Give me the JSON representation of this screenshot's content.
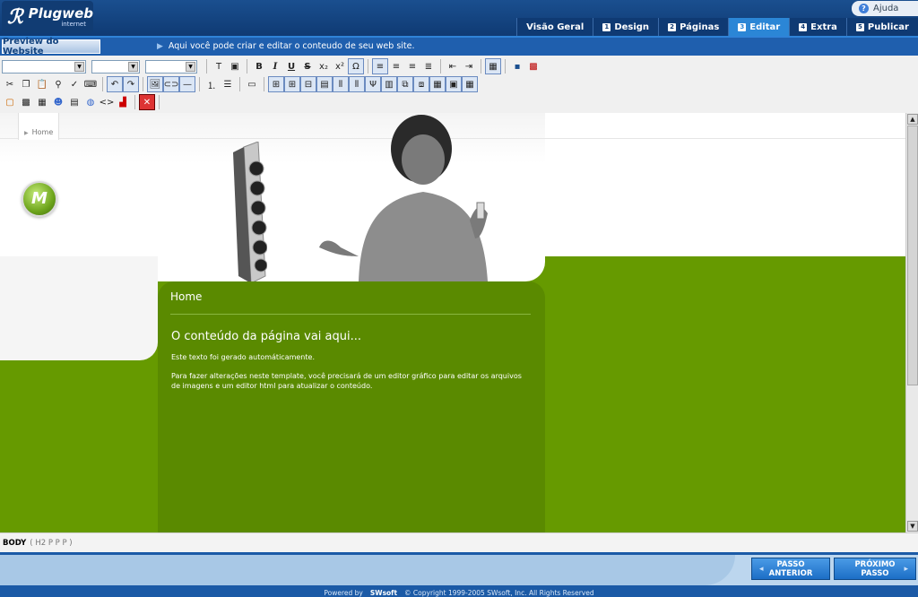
{
  "header": {
    "logo_title": "Plugweb",
    "logo_sub": "internet",
    "help_label": "Ajuda",
    "tabs": [
      {
        "num": "",
        "label": "Visão Geral"
      },
      {
        "num": "1",
        "label": "Design"
      },
      {
        "num": "2",
        "label": "Páginas"
      },
      {
        "num": "3",
        "label": "Editar"
      },
      {
        "num": "4",
        "label": "Extra"
      },
      {
        "num": "5",
        "label": "Publicar"
      }
    ]
  },
  "subbar": {
    "preview_label": "Preview do Website",
    "message": "Aqui você pode criar e editar o conteudo de seu web site."
  },
  "page": {
    "breadcrumb": "Home",
    "content_title": "Home",
    "heading": "O conteúdo da página vai aqui...",
    "para1": "Este texto foi gerado automáticamente.",
    "para2": "Para fazer alterações neste template, você precisará de um editor gráfico para editar os arquivos de imagens e um editor html para atualizar o conteúdo."
  },
  "statusbar": {
    "body_tag": "BODY",
    "path": "( H2 P P P )"
  },
  "footer": {
    "prev_label_1": "PASSO",
    "prev_label_2": "ANTERIOR",
    "next_label_1": "PRÓXIMO",
    "next_label_2": "PASSO",
    "powered_by": "Powered by",
    "vendor": "SWsoft",
    "copyright": "© Copyright 1999-2005 SWsoft, Inc. All Rights Reserved"
  },
  "colors": {
    "header_blue": "#0f3a73",
    "active_tab": "#2b86d6",
    "green": "#669a00",
    "content_green": "#5a8a00"
  }
}
